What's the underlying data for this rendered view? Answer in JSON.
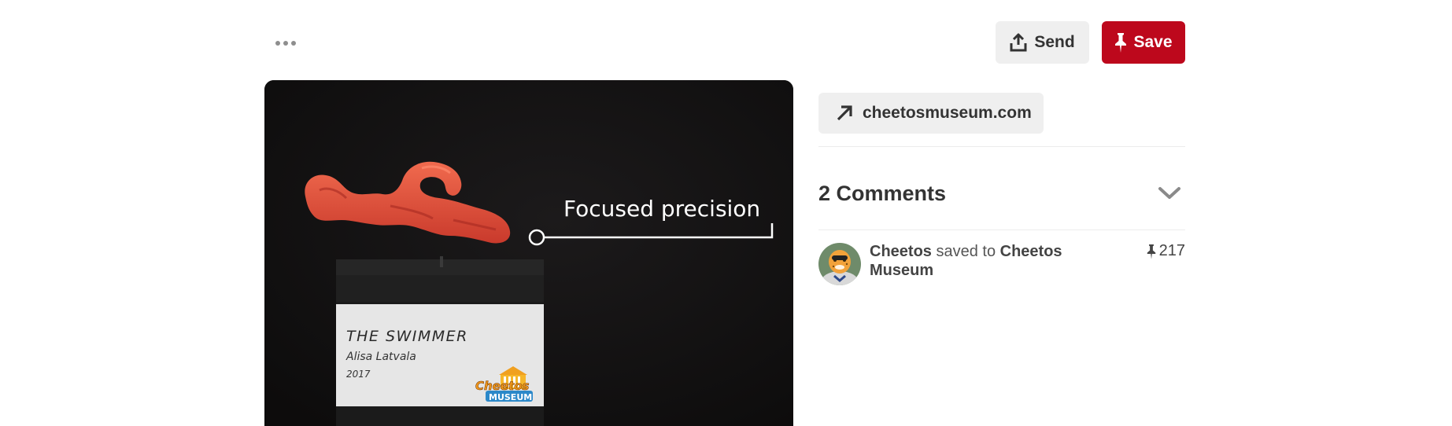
{
  "toolbar": {
    "more_icon": "ellipsis-icon",
    "send_label": "Send",
    "send_icon": "share-upload-icon",
    "save_label": "Save",
    "save_icon": "pushpin-icon",
    "save_color": "#bd081c"
  },
  "pin_image": {
    "overlay_text": "Focused precision",
    "placard_title": "THE SWIMMER",
    "placard_artist": "Alisa Latvala",
    "placard_year": "2017",
    "logo_text_top": "Cheetos",
    "logo_text_bottom": "MUSEUM"
  },
  "source": {
    "icon": "arrow-up-right-icon",
    "label": "cheetosmuseum.com"
  },
  "comments": {
    "title": "2 Comments",
    "toggle_icon": "chevron-down-icon"
  },
  "activity": {
    "user": "Cheetos",
    "action": "saved to",
    "board": "Cheetos Museum",
    "pin_count": "217"
  }
}
